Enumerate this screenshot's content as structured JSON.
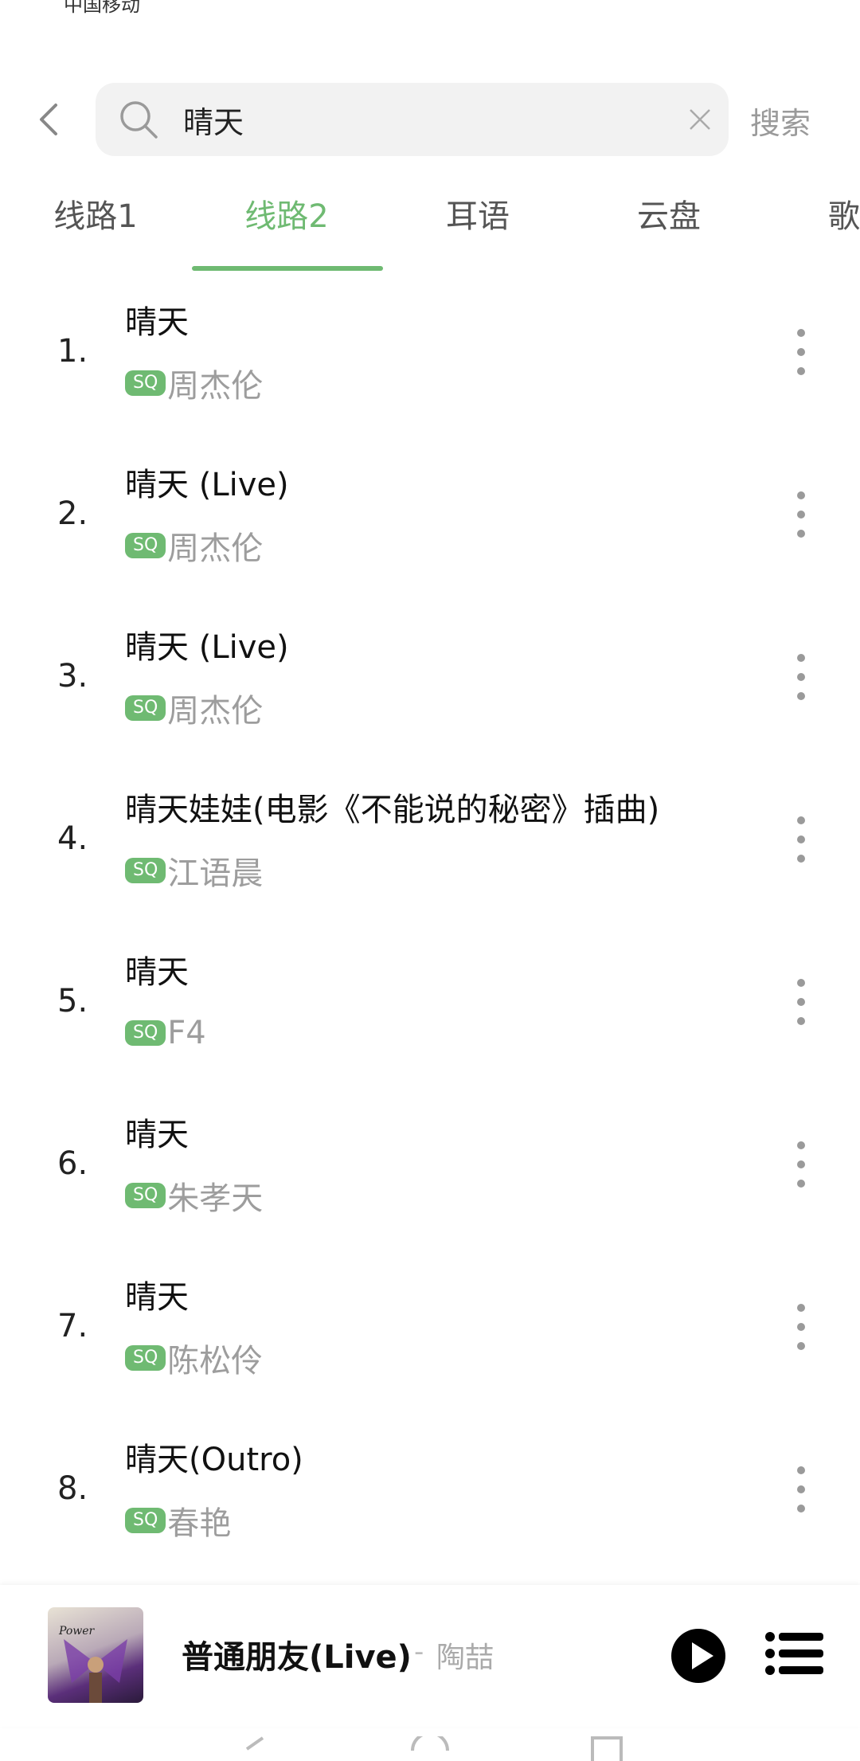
{
  "status": {
    "carrier": "中国移动"
  },
  "search": {
    "value": "晴天",
    "button_label": "搜索"
  },
  "tabs": [
    {
      "label": "线路1",
      "active": false
    },
    {
      "label": "线路2",
      "active": true
    },
    {
      "label": "耳语",
      "active": false
    },
    {
      "label": "云盘",
      "active": false
    },
    {
      "label": "歌曲",
      "active": false
    }
  ],
  "results": [
    {
      "index": "1.",
      "title": "晴天",
      "badge": "SQ",
      "artist": "周杰伦"
    },
    {
      "index": "2.",
      "title": "晴天 (Live)",
      "badge": "SQ",
      "artist": "周杰伦"
    },
    {
      "index": "3.",
      "title": "晴天 (Live)",
      "badge": "SQ",
      "artist": "周杰伦"
    },
    {
      "index": "4.",
      "title": "晴天娃娃(电影《不能说的秘密》插曲)",
      "badge": "SQ",
      "artist": "江语晨"
    },
    {
      "index": "5.",
      "title": "晴天",
      "badge": "SQ",
      "artist": "F4"
    },
    {
      "index": "6.",
      "title": "晴天",
      "badge": "SQ",
      "artist": "朱孝天"
    },
    {
      "index": "7.",
      "title": "晴天",
      "badge": "SQ",
      "artist": "陈松伶"
    },
    {
      "index": "8.",
      "title": "晴天(Outro)",
      "badge": "SQ",
      "artist": "春艳"
    }
  ],
  "now_playing": {
    "title": "普通朋友(Live)",
    "separator": "-",
    "artist": "陶喆"
  },
  "colors": {
    "accent": "#6fba72",
    "muted": "#9d9d9d",
    "search_bg": "#f2f2f2"
  },
  "icons": {
    "back": "chevron-left-icon",
    "search": "search-icon",
    "clear": "close-icon",
    "more": "more-vertical-icon",
    "play": "play-icon",
    "playlist": "playlist-icon"
  }
}
